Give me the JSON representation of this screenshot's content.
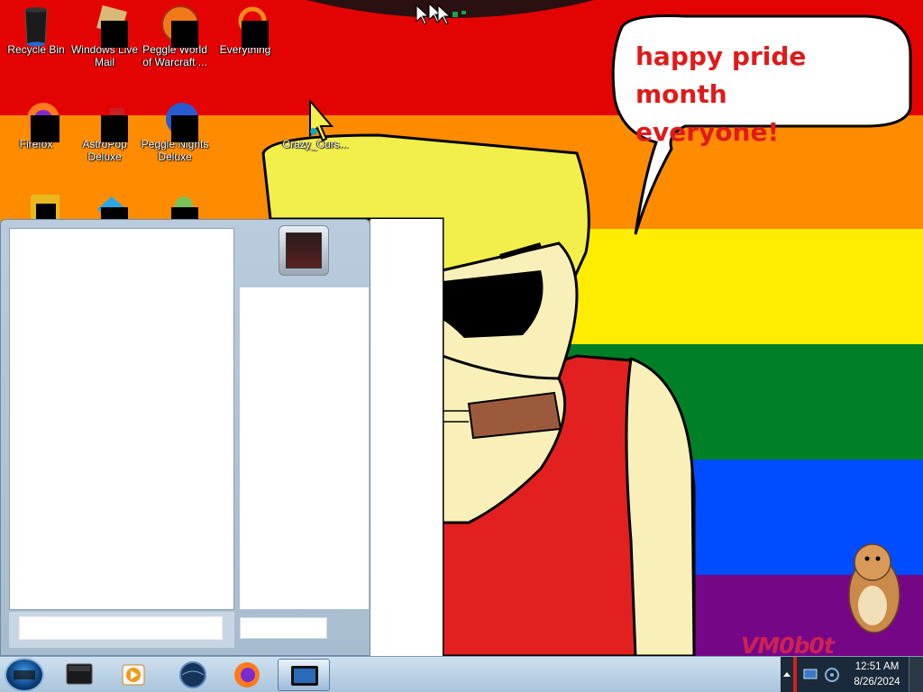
{
  "desktop": {
    "icons": [
      {
        "label": "Recycle Bin"
      },
      {
        "label": "Windows Live Mail"
      },
      {
        "label": "Peggle World of Warcraft ..."
      },
      {
        "label": "Everything"
      },
      {
        "label": "Firefox"
      },
      {
        "label": "AstroPop Deluxe"
      },
      {
        "label": "Peggle Nights Deluxe"
      },
      {
        "label": "Crazy_Curs..."
      }
    ],
    "speech_bubble": {
      "line1": "happy pride month",
      "line2": "everyone!"
    },
    "watermark": "VM0b0t"
  },
  "taskbar": {
    "items": [
      {
        "name": "start-orb",
        "icon": "windows-orb-icon"
      },
      {
        "name": "taskbar-app-1",
        "icon": "terminal-icon"
      },
      {
        "name": "taskbar-app-2",
        "icon": "media-player-icon"
      },
      {
        "name": "taskbar-app-3",
        "icon": "globe-icon"
      },
      {
        "name": "taskbar-app-4",
        "icon": "firefox-icon"
      },
      {
        "name": "taskbar-app-5",
        "icon": "window-icon",
        "active": true
      }
    ],
    "clock": {
      "time": "12:51 AM",
      "date": "8/26/2024"
    }
  },
  "colors": {
    "red": "#e40303",
    "orange": "#ff8c00",
    "yellow": "#ffed00",
    "green": "#008026",
    "blue": "#004dff",
    "purple": "#750787"
  }
}
